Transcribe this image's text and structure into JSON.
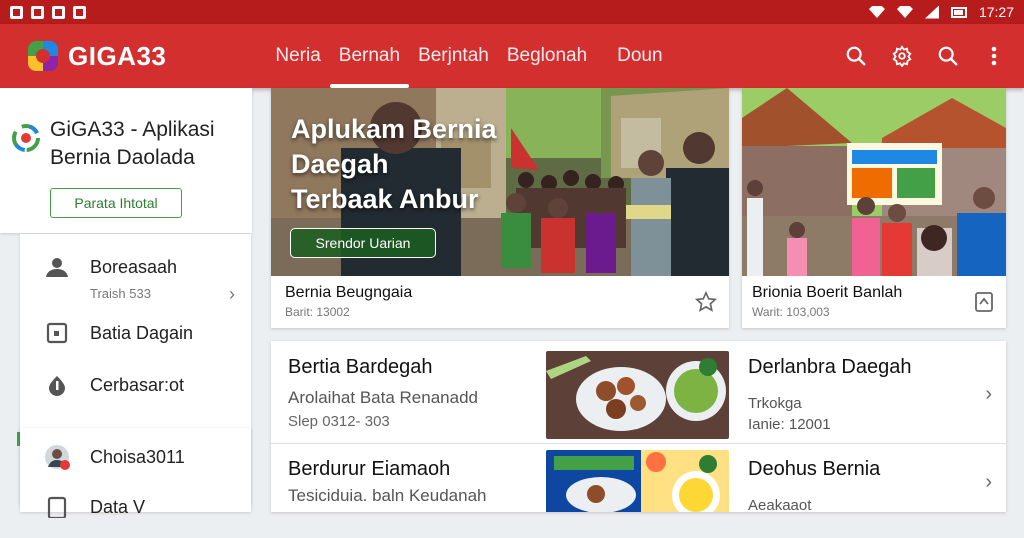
{
  "status": {
    "time": "17:27"
  },
  "app": {
    "name": "GIGA33",
    "tabs": [
      {
        "label": "Neria"
      },
      {
        "label": "Bernah"
      },
      {
        "label": "Berjntah"
      },
      {
        "label": "Beglonah"
      },
      {
        "label": "Doun"
      }
    ]
  },
  "sidebar": {
    "app_title_line1": "GiGA33 - Aplikasi",
    "app_title_line2": "Bernia Daolada",
    "install_label": "Parata Ihtotal",
    "items": [
      {
        "label": "Boreasaah",
        "sub": "Traish 533",
        "icon": "person-icon"
      },
      {
        "label": "Batia Dagain",
        "icon": "square-icon"
      },
      {
        "label": "Cerbasar:ot",
        "icon": "drop-icon"
      }
    ],
    "user": {
      "label": "Choisa3011"
    },
    "last_item": {
      "label": "Data V"
    }
  },
  "hero": {
    "title_line1": "Aplukam Bernia",
    "title_line2": "Daegah",
    "title_line3": "Terbaak Anbur",
    "button": "Srendor Uarian",
    "caption": "Bernia Beugngaia",
    "caption_sub": "Barit: 13002"
  },
  "side_card": {
    "caption": "Brionia Boerit Banlah",
    "caption_sub": "Warit: 103,003"
  },
  "list": [
    {
      "title": "Bertia Bardegah",
      "sub": "Arolaihat Bata Renanadd",
      "meta": "Slep 0312- 303",
      "right_title": "Derlanbra Daegah",
      "right_sub1": "Trkokga",
      "right_sub2": "Ianie: 12001"
    },
    {
      "title": "Berdurur Eiamaoh",
      "sub": "Tesiciduia. baln Keudanah",
      "meta": "",
      "right_title": "Deohus Bernia",
      "right_sub1": "Aeakaaot",
      "right_sub2": ""
    }
  ],
  "colors": {
    "brand": "#d32f2f",
    "status": "#b71c1c",
    "accent": "#43a047"
  }
}
